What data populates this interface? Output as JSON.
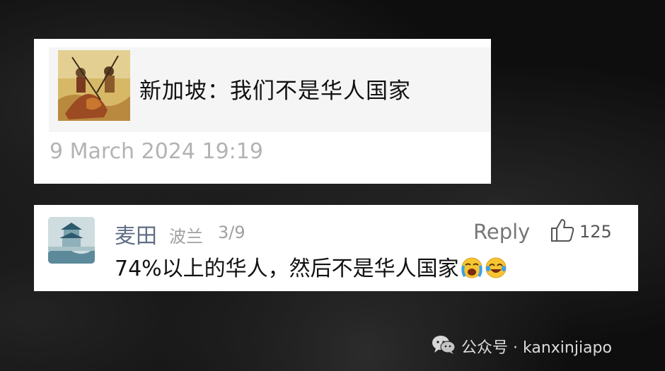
{
  "shared_post": {
    "title": "新加坡：我们不是华人国家",
    "date": "9 March 2024 19:19",
    "thumbnail_icon": "ancient-warrior-painting-thumbnail"
  },
  "comment": {
    "username": "麦田",
    "location": "波兰",
    "date": "3/9",
    "reply_label": "Reply",
    "like_count": "125",
    "text": "74%以上的华人，然后不是华人国家",
    "emojis": [
      "loudly-crying-face-icon",
      "face-with-tears-of-joy-icon"
    ],
    "avatar_icon": "pavilion-landscape-avatar"
  },
  "watermark": {
    "icon": "wechat-icon",
    "text": "公众号 · kanxinjiapo"
  },
  "colors": {
    "card_bg": "#ffffff",
    "shared_box_bg": "#f5f5f5",
    "username": "#5f6e85",
    "meta_gray": "#a0a0a0",
    "background": "#0e0e0e"
  }
}
